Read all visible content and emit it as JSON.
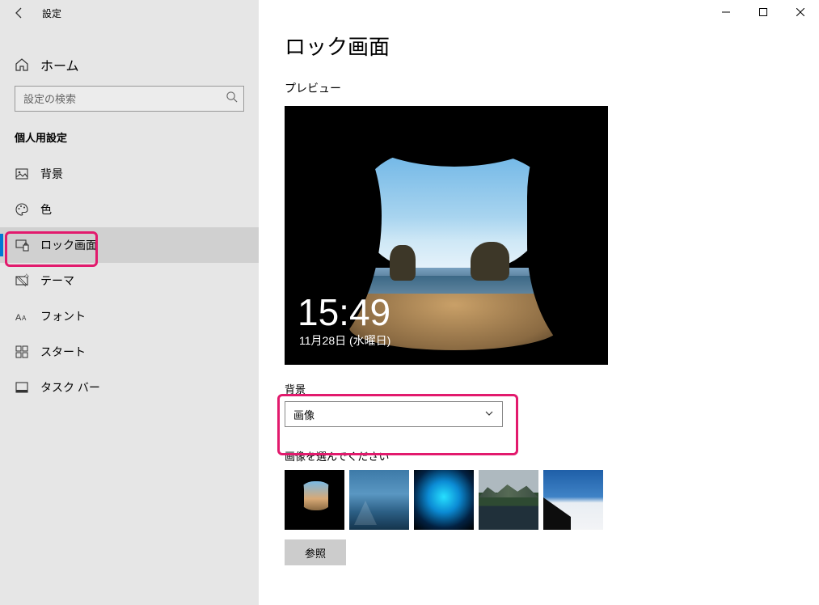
{
  "window": {
    "title": "設定"
  },
  "sidebar": {
    "home_label": "ホーム",
    "search_placeholder": "設定の検索",
    "section_title": "個人用設定",
    "items": [
      {
        "label": "背景"
      },
      {
        "label": "色"
      },
      {
        "label": "ロック画面"
      },
      {
        "label": "テーマ"
      },
      {
        "label": "フォント"
      },
      {
        "label": "スタート"
      },
      {
        "label": "タスク バー"
      }
    ]
  },
  "main": {
    "title": "ロック画面",
    "preview_label": "プレビュー",
    "preview_time": "15:49",
    "preview_date": "11月28日 (水曜日)",
    "background_label": "背景",
    "background_select_value": "画像",
    "choose_label": "画像を選んでください",
    "browse_label": "参照"
  }
}
